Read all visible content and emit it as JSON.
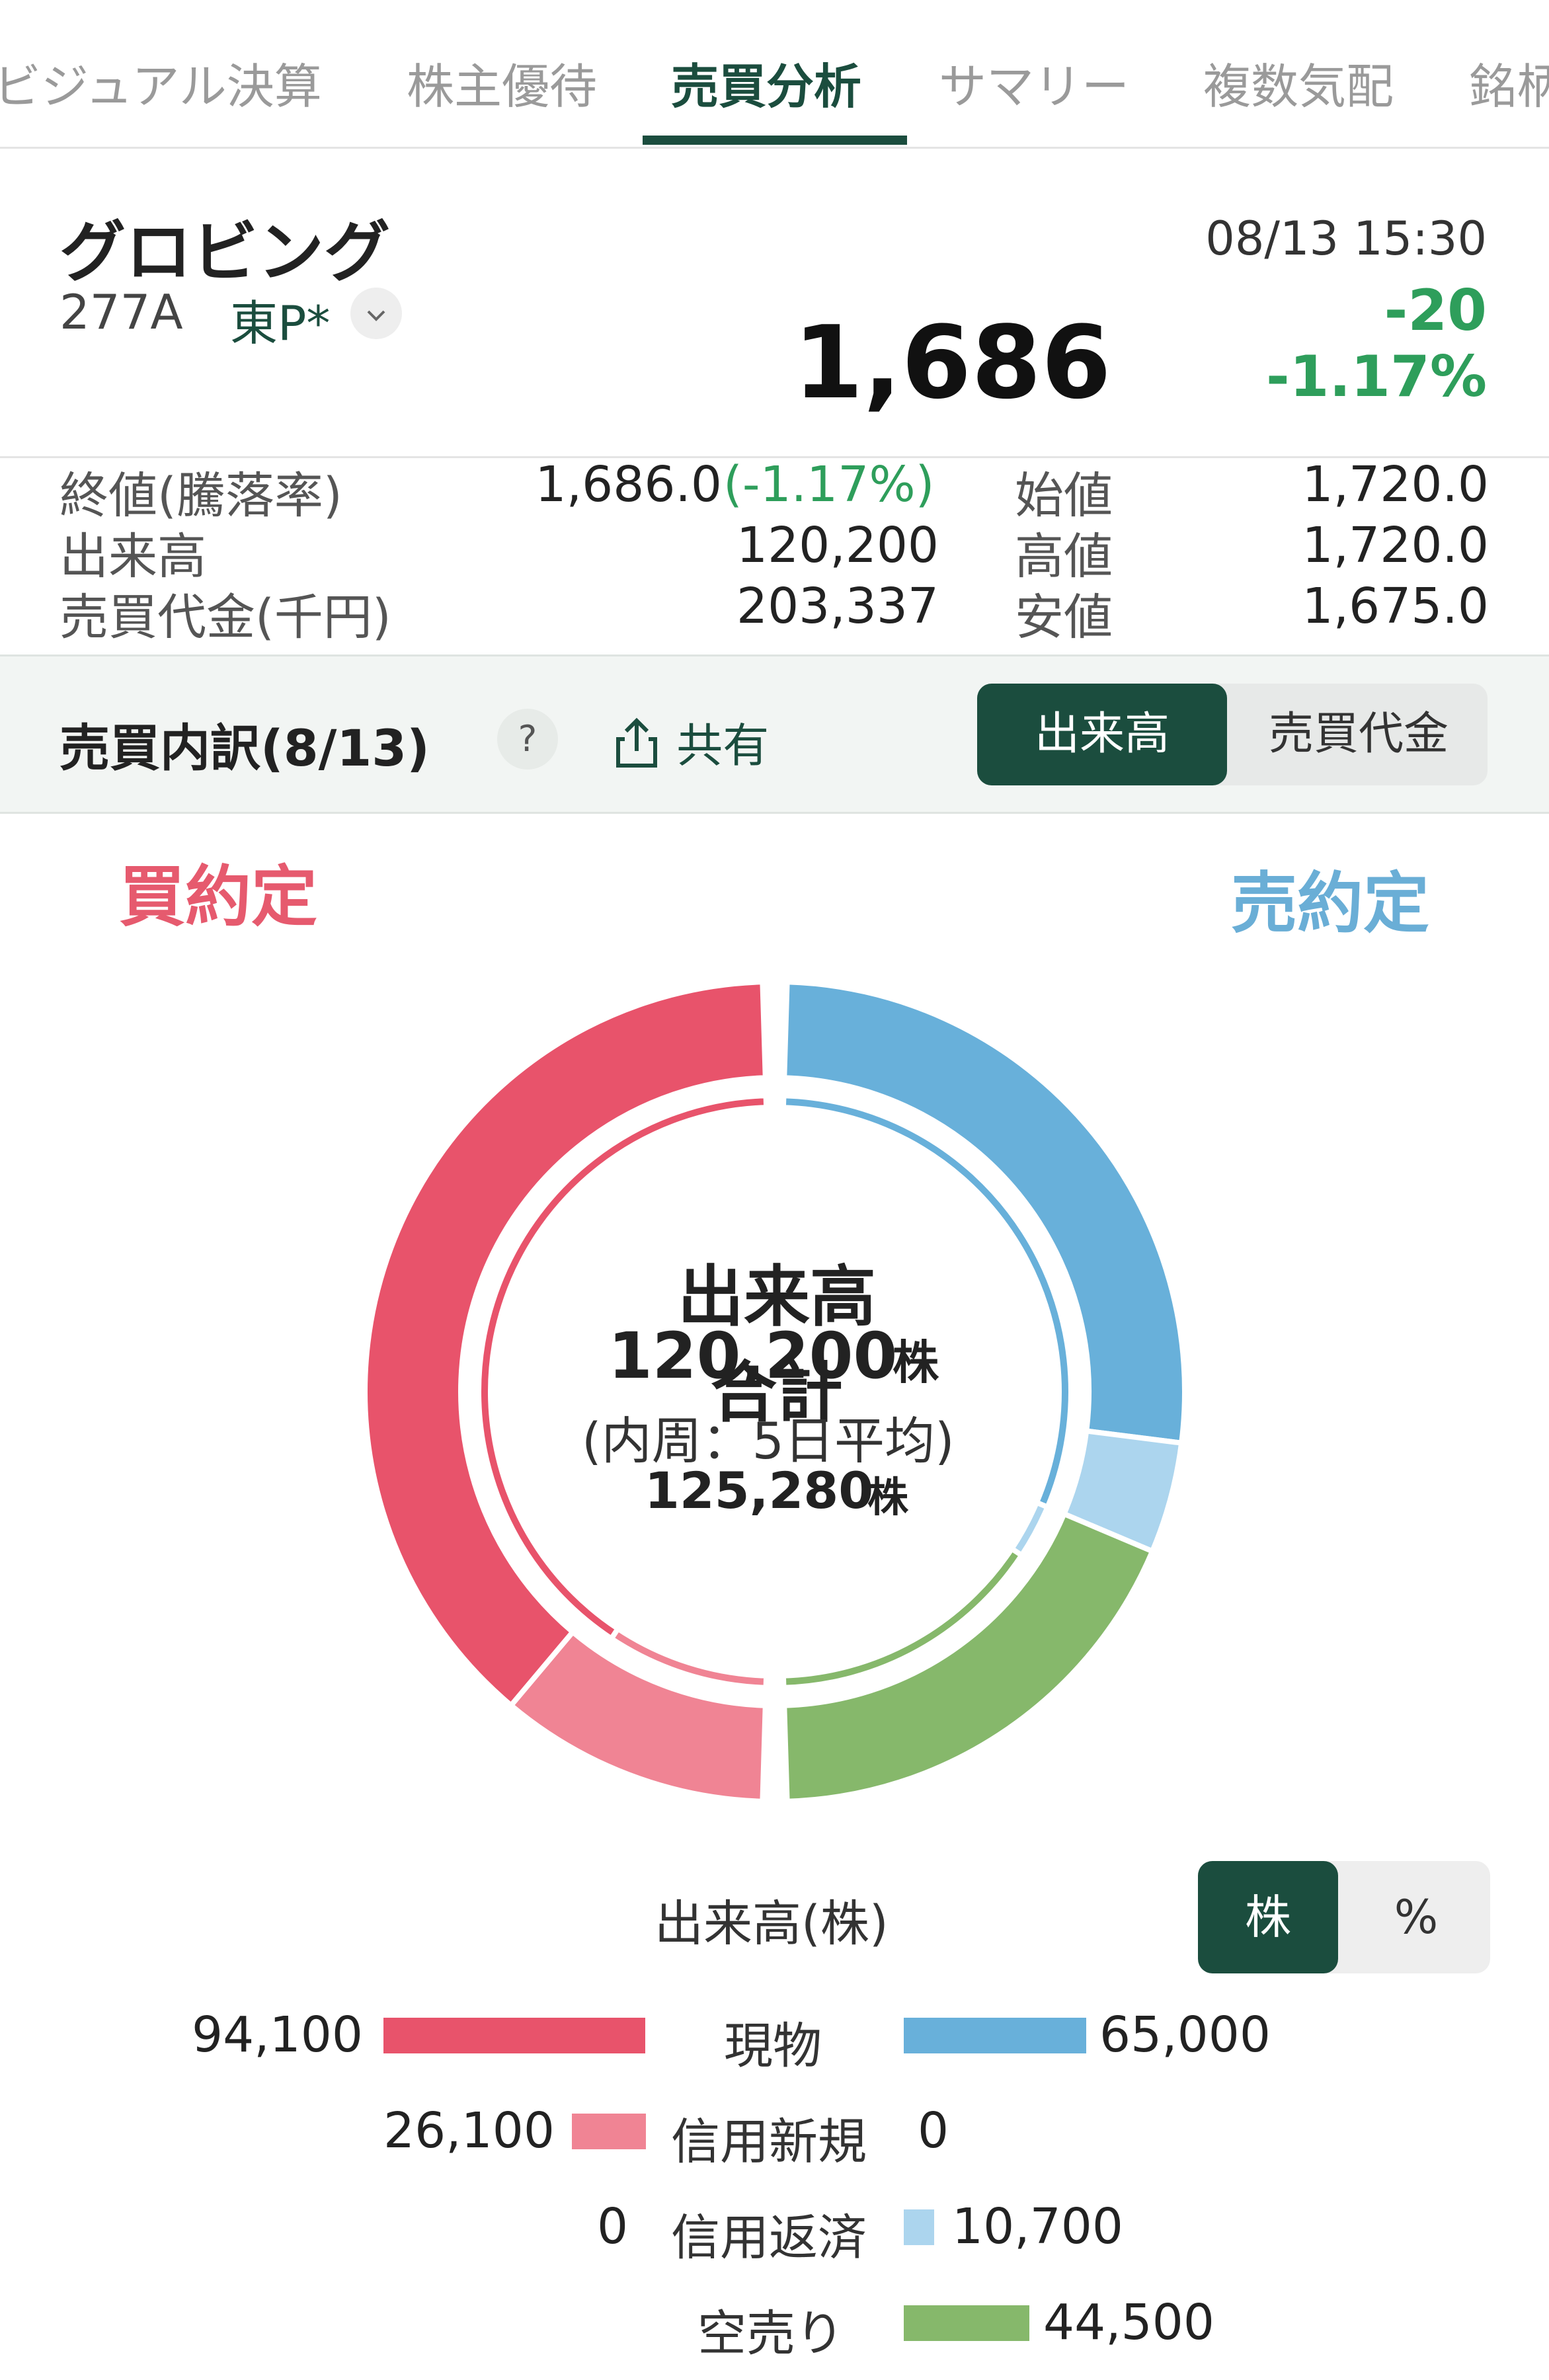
{
  "tabs": [
    {
      "label": "ビジュアル決算",
      "active": false
    },
    {
      "label": "株主優待",
      "active": false
    },
    {
      "label": "売買分析",
      "active": true
    },
    {
      "label": "サマリー",
      "active": false
    },
    {
      "label": "複数気配",
      "active": false
    },
    {
      "label": "銘柄",
      "active": false
    }
  ],
  "stock": {
    "name": "グロビング",
    "code": "277A",
    "market": "東P*",
    "datetime": "08/13 15:30",
    "price": "1,686",
    "change": "-20",
    "change_pct": "-1.17%"
  },
  "stats": {
    "close_label": "終値(騰落率)",
    "close_value": "1,686.0",
    "close_pct": "(-1.17%)",
    "volume_label": "出来高",
    "volume_value": "120,200",
    "turnover_label": "売買代金(千円)",
    "turnover_value": "203,337",
    "open_label": "始値",
    "open_value": "1,720.0",
    "high_label": "高値",
    "high_value": "1,720.0",
    "low_label": "安値",
    "low_value": "1,675.0"
  },
  "breakdown": {
    "title": "売買内訳(8/13)",
    "help": "?",
    "share_label": "共有",
    "toggle_volume": "出来高",
    "toggle_turnover": "売買代金",
    "selected": "出来高"
  },
  "buy_label": "買約定",
  "sell_label": "売約定",
  "donut": {
    "center_title": "出来高合計",
    "total": "120,200",
    "unit": "株",
    "inner_note": "(内周：5日平均)",
    "avg": "125,280"
  },
  "legend": {
    "title": "出来高(株)",
    "unit_toggle": {
      "shares": "株",
      "percent": "%",
      "selected": "株"
    },
    "rows": [
      {
        "category": "現物",
        "buy": "94,100",
        "sell": "65,000"
      },
      {
        "category": "信用新規",
        "buy": "26,100",
        "sell": "0"
      },
      {
        "category": "信用返済",
        "buy": "0",
        "sell": "10,700"
      },
      {
        "category": "空売り",
        "buy": "",
        "sell": "44,500"
      }
    ]
  },
  "chart_data": {
    "type": "donut",
    "unit": "株",
    "total": 120200,
    "outer": {
      "buy": [
        {
          "name": "現物",
          "value": 94100,
          "color": "#e8536b"
        },
        {
          "name": "信用新規",
          "value": 26100,
          "color": "#f08494"
        },
        {
          "name": "信用返済",
          "value": 0,
          "color": "#f2b8c2"
        }
      ],
      "sell": [
        {
          "name": "現物",
          "value": 65000,
          "color": "#68b0da"
        },
        {
          "name": "信用新規",
          "value": 0,
          "color": "#8fc3e3"
        },
        {
          "name": "信用返済",
          "value": 10700,
          "color": "#acd5ee"
        },
        {
          "name": "空売り",
          "value": 44500,
          "color": "#86b86b"
        }
      ]
    },
    "inner_5day_avg_total": 125280,
    "inner": {
      "buy": [
        {
          "name": "現物",
          "share": 0.82
        },
        {
          "name": "信用新規",
          "share": 0.18
        }
      ],
      "sell": [
        {
          "name": "現物",
          "share": 0.63
        },
        {
          "name": "信用返済",
          "share": 0.06
        },
        {
          "name": "空売り",
          "share": 0.31
        }
      ]
    }
  }
}
